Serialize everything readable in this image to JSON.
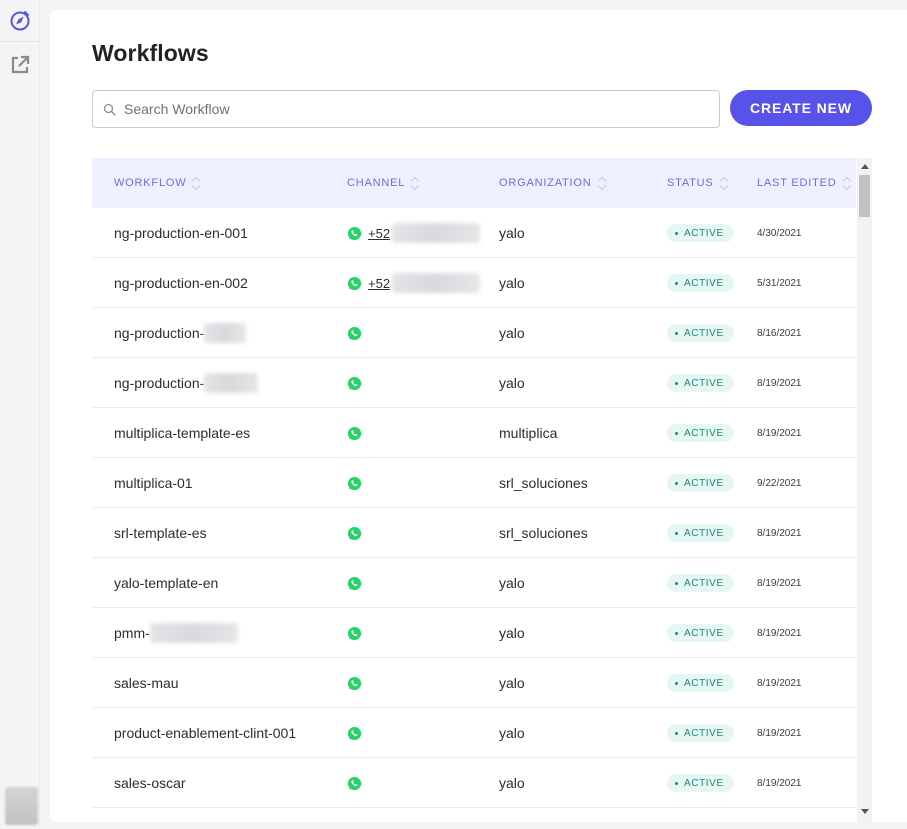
{
  "rail": {
    "items": [
      {
        "icon": "compass-icon"
      },
      {
        "icon": "external-link-icon"
      }
    ]
  },
  "page": {
    "title": "Workflows"
  },
  "search": {
    "placeholder": "Search Workflow",
    "value": ""
  },
  "actions": {
    "create_label": "CREATE NEW"
  },
  "table": {
    "columns": [
      "WORKFLOW",
      "CHANNEL",
      "ORGANIZATION",
      "STATUS",
      "LAST EDITED"
    ],
    "rows": [
      {
        "workflow": "ng-production-en-001",
        "channel": "+52",
        "organization": "yalo",
        "status": "ACTIVE",
        "last_edited": "4/30/2021"
      },
      {
        "workflow": "ng-production-en-002",
        "channel": "+52",
        "organization": "yalo",
        "status": "ACTIVE",
        "last_edited": "5/31/2021"
      },
      {
        "workflow": "ng-production-",
        "channel": "",
        "organization": "yalo",
        "status": "ACTIVE",
        "last_edited": "8/16/2021"
      },
      {
        "workflow": "ng-production-",
        "channel": "",
        "organization": "yalo",
        "status": "ACTIVE",
        "last_edited": "8/19/2021"
      },
      {
        "workflow": "multiplica-template-es",
        "channel": "",
        "organization": "multiplica",
        "status": "ACTIVE",
        "last_edited": "8/19/2021"
      },
      {
        "workflow": "multiplica-01",
        "channel": "",
        "organization": "srl_soluciones",
        "status": "ACTIVE",
        "last_edited": "9/22/2021"
      },
      {
        "workflow": "srl-template-es",
        "channel": "",
        "organization": "srl_soluciones",
        "status": "ACTIVE",
        "last_edited": "8/19/2021"
      },
      {
        "workflow": "yalo-template-en",
        "channel": "",
        "organization": "yalo",
        "status": "ACTIVE",
        "last_edited": "8/19/2021"
      },
      {
        "workflow": "pmm-",
        "channel": "",
        "organization": "yalo",
        "status": "ACTIVE",
        "last_edited": "8/19/2021"
      },
      {
        "workflow": "sales-mau",
        "channel": "",
        "organization": "yalo",
        "status": "ACTIVE",
        "last_edited": "8/19/2021"
      },
      {
        "workflow": "product-enablement-clint-001",
        "channel": "",
        "organization": "yalo",
        "status": "ACTIVE",
        "last_edited": "8/19/2021"
      },
      {
        "workflow": "sales-oscar",
        "channel": "",
        "organization": "yalo",
        "status": "ACTIVE",
        "last_edited": "8/19/2021"
      }
    ]
  },
  "colors": {
    "accent": "#5753ea",
    "header_bg": "#eef0ff",
    "header_text": "#6b6ee0",
    "active_bg": "#e6f6f2",
    "active_text": "#1d8a75",
    "whatsapp": "#25d366"
  }
}
